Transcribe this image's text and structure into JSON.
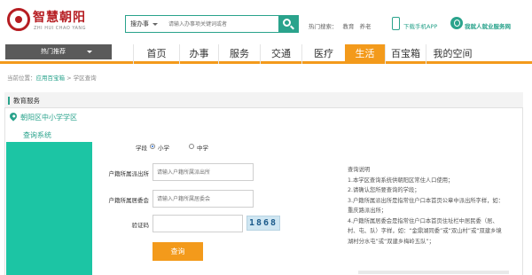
{
  "header": {
    "logo_cn": "智慧朝阳",
    "logo_pinyin": "ZHI HUI CHAO YANG",
    "search": {
      "type_label": "搜办事",
      "placeholder": "请输入办事项关键词或者"
    },
    "hot_label": "热门搜索：",
    "hot_terms": [
      "教育",
      "养老"
    ],
    "phone_link": "下载手机APP",
    "service_link": "我就人就业服务网"
  },
  "nav": {
    "recommend": "热门推荐",
    "items": [
      "首页",
      "办事",
      "服务",
      "交通",
      "医疗",
      "生活",
      "百宝箱",
      "我的空间"
    ],
    "active": "生活"
  },
  "breadcrumb": {
    "prefix": "当前位置：",
    "link": "应用百宝箱",
    "sep": ">",
    "current": "学区查询"
  },
  "section": {
    "title": "教育服务",
    "district": "朝阳区中小学学区",
    "query_system": "查询系统"
  },
  "form": {
    "school_label": "学段",
    "radio_primary": "小学",
    "radio_middle": "中学",
    "primary_selected": true,
    "district_label": "户籍所属派出所",
    "district_placeholder": "请输入户籍所属派出所",
    "committee_label": "户籍所属居委会",
    "committee_placeholder": "请输入户籍所属居委会",
    "captcha_label": "验证码",
    "captcha_value": "1868",
    "submit": "查询"
  },
  "notes": {
    "title": "查询说明",
    "lines": [
      "1.本学区查询系统供朝阳区常住人口使用；",
      "2.请确认您所要查询的学段；",
      "3.户籍所属派出所是指常住户口本首页公章中派出所字样，如：重庆路派出所；",
      "4.户籍所属居委会是指常住户口本首页住址栏中居民委（居、村、屯、队）字样，如：“金鼎湖同委”或“双山村”或“双建乡境湖村分水屯”或“双建乡梅岭五队”；"
    ]
  },
  "colors": {
    "accent": "#2aa38c",
    "nav_active": "#f39a1b",
    "panel": "#1cc5a4",
    "brand": "#b61d22"
  }
}
